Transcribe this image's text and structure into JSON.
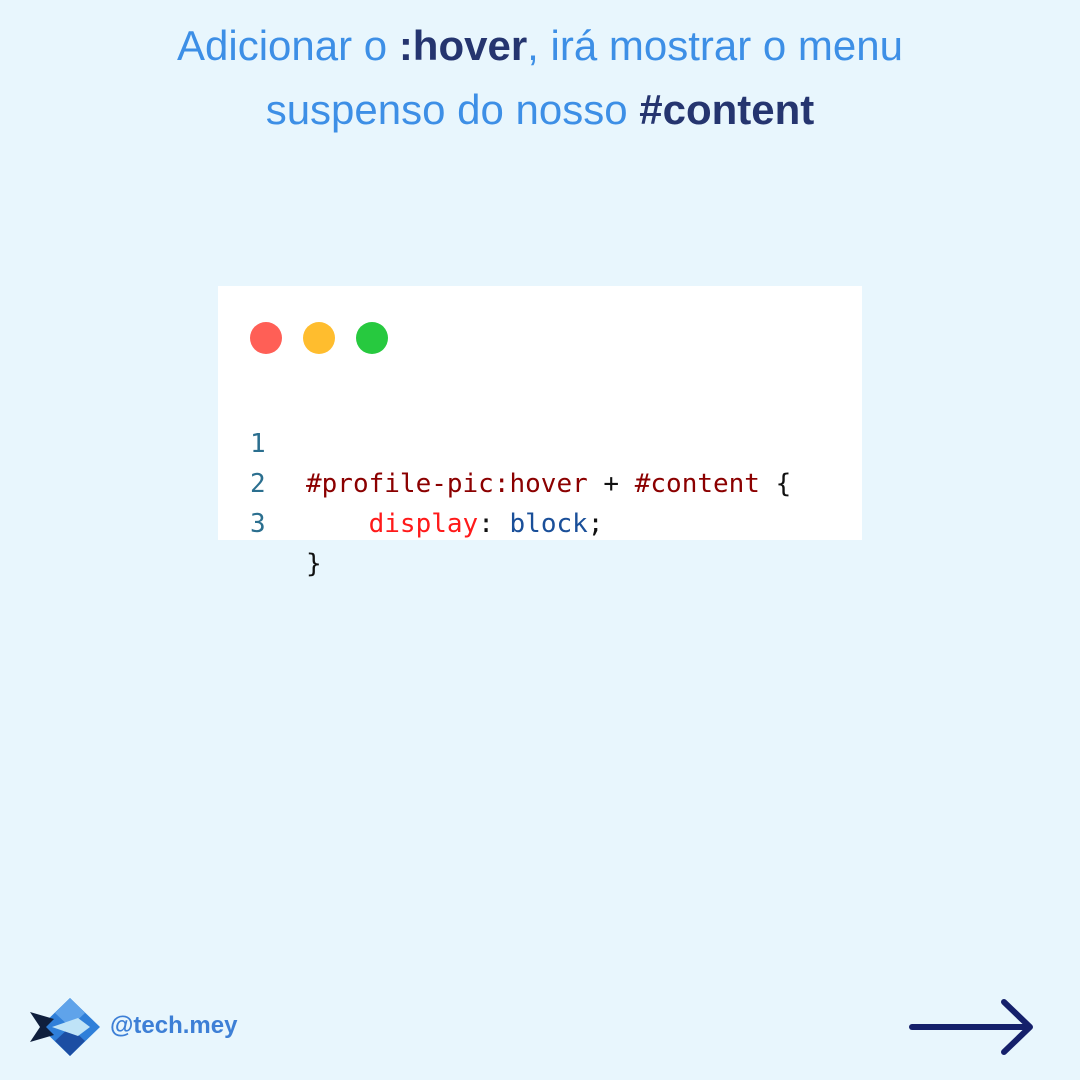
{
  "headline": {
    "line1_pre": "Adicionar o ",
    "line1_strong": ":hover",
    "line1_post": ", irá mostrar o menu",
    "line2_pre": "suspenso do nosso ",
    "line2_strong": "#content"
  },
  "code_window": {
    "dots": [
      "red",
      "yellow",
      "green"
    ],
    "lines": [
      {
        "number": "1",
        "selector": "#profile-pic:hover",
        "combinator": " + ",
        "target": "#content",
        "brace_open": " {"
      },
      {
        "number": "2",
        "indent": "    ",
        "property": "display",
        "colon": ": ",
        "value": "block",
        "semicolon": ";"
      },
      {
        "number": "3",
        "brace_close": "}"
      }
    ]
  },
  "footer": {
    "logo_icon": "diamond-fish-logo-icon",
    "handle": "@tech.mey",
    "next_icon": "right-arrow-icon"
  },
  "colors": {
    "background": "#e8f6fd",
    "headline": "#3d8fe6",
    "headline_strong": "#25356f",
    "selector": "#8b0000",
    "property": "#ff1a1a",
    "value": "#1a4f99",
    "arrow": "#15206b"
  }
}
